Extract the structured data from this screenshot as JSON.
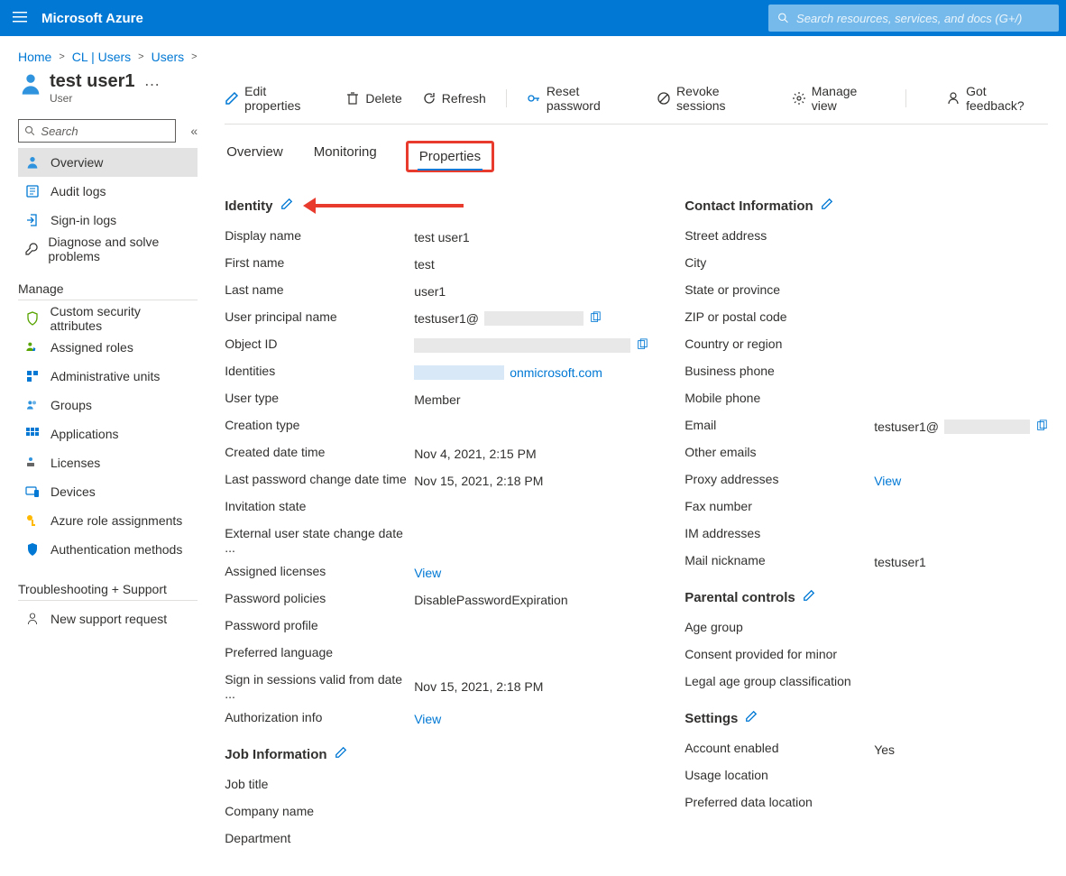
{
  "header": {
    "brand": "Microsoft Azure",
    "search_placeholder": "Search resources, services, and docs (G+/)"
  },
  "breadcrumb": [
    "Home",
    "CL | Users",
    "Users"
  ],
  "page": {
    "title": "test user1",
    "subtitle": "User"
  },
  "nav": {
    "search_placeholder": "Search",
    "top": [
      "Overview",
      "Audit logs",
      "Sign-in logs",
      "Diagnose and solve problems"
    ],
    "manage_title": "Manage",
    "manage": [
      "Custom security attributes",
      "Assigned roles",
      "Administrative units",
      "Groups",
      "Applications",
      "Licenses",
      "Devices",
      "Azure role assignments",
      "Authentication methods"
    ],
    "trouble_title": "Troubleshooting + Support",
    "trouble": [
      "New support request"
    ]
  },
  "cmd": {
    "edit": "Edit properties",
    "delete": "Delete",
    "refresh": "Refresh",
    "reset": "Reset password",
    "revoke": "Revoke sessions",
    "manage": "Manage view",
    "feedback": "Got feedback?"
  },
  "tabs": {
    "overview": "Overview",
    "monitoring": "Monitoring",
    "properties": "Properties"
  },
  "sections": {
    "identity": "Identity",
    "job": "Job Information",
    "contact": "Contact Information",
    "parental": "Parental controls",
    "settings": "Settings"
  },
  "identity": {
    "display_name_k": "Display name",
    "display_name_v": "test user1",
    "first_name_k": "First name",
    "first_name_v": "test",
    "last_name_k": "Last name",
    "last_name_v": "user1",
    "upn_k": "User principal name",
    "upn_v": "testuser1@",
    "object_id_k": "Object ID",
    "identities_k": "Identities",
    "identities_suffix": "onmicrosoft.com",
    "user_type_k": "User type",
    "user_type_v": "Member",
    "creation_type_k": "Creation type",
    "created_k": "Created date time",
    "created_v": "Nov 4, 2021, 2:15 PM",
    "last_pwd_k": "Last password change date time",
    "last_pwd_v": "Nov 15, 2021, 2:18 PM",
    "invitation_k": "Invitation state",
    "extstate_k": "External user state change date ...",
    "assigned_lic_k": "Assigned licenses",
    "view": "View",
    "pwd_policies_k": "Password policies",
    "pwd_policies_v": "DisablePasswordExpiration",
    "pwd_profile_k": "Password profile",
    "pref_lang_k": "Preferred language",
    "signin_valid_k": "Sign in sessions valid from date ...",
    "signin_valid_v": "Nov 15, 2021, 2:18 PM",
    "auth_info_k": "Authorization info"
  },
  "job": {
    "title_k": "Job title",
    "company_k": "Company name",
    "department_k": "Department"
  },
  "contact": {
    "street_k": "Street address",
    "city_k": "City",
    "state_k": "State or province",
    "zip_k": "ZIP or postal code",
    "country_k": "Country or region",
    "bphone_k": "Business phone",
    "mphone_k": "Mobile phone",
    "email_k": "Email",
    "email_v": "testuser1@",
    "other_emails_k": "Other emails",
    "proxy_k": "Proxy addresses",
    "view": "View",
    "fax_k": "Fax number",
    "im_k": "IM addresses",
    "mail_nick_k": "Mail nickname",
    "mail_nick_v": "testuser1"
  },
  "parental": {
    "age_k": "Age group",
    "consent_k": "Consent provided for minor",
    "legal_k": "Legal age group classification"
  },
  "settings": {
    "enabled_k": "Account enabled",
    "enabled_v": "Yes",
    "usage_k": "Usage location",
    "prefdata_k": "Preferred data location"
  }
}
